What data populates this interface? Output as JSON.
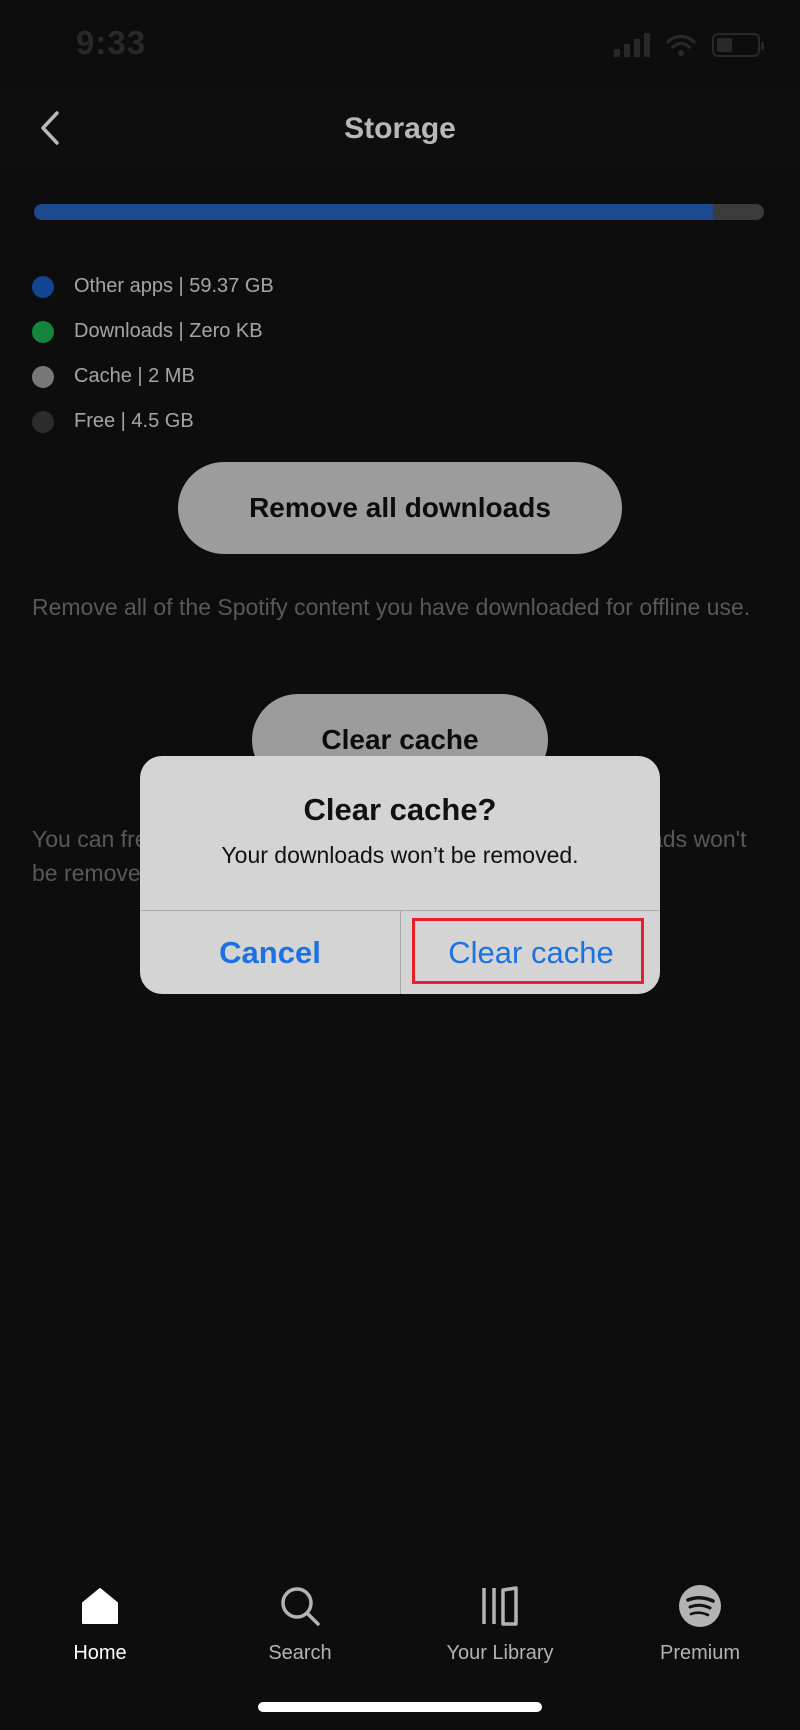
{
  "status_bar": {
    "time": "9:33"
  },
  "header": {
    "title": "Storage",
    "back_icon": "chevron-left-icon"
  },
  "storage": {
    "used_fraction": 0.93,
    "colors": {
      "other_apps": "#2a64c6",
      "free": "#535353"
    },
    "legend": [
      {
        "label": "Other apps | 59.37 GB",
        "color": "#1a5fc9"
      },
      {
        "label": "Downloads | Zero KB",
        "color": "#1db954"
      },
      {
        "label": "Cache | 2 MB",
        "color": "#a7a7a7"
      },
      {
        "label": "Free | 4.5 GB",
        "color": "#3e3e3e"
      }
    ]
  },
  "actions": {
    "remove_label": "Remove all downloads",
    "remove_desc": "Remove all of the Spotify content you have downloaded for offline use.",
    "clear_cache_label": "Clear cache",
    "cache_desc": "You can free up storage by clearing your cache. Your downloads won't be removed."
  },
  "alert": {
    "title": "Clear cache?",
    "message": "Your downloads won’t be removed.",
    "cancel_label": "Cancel",
    "confirm_label": "Clear cache",
    "button_color": "#1c72e0",
    "highlight_color": "#e8202a"
  },
  "nav": {
    "items": [
      {
        "label": "Home",
        "icon": "home-icon",
        "active": true
      },
      {
        "label": "Search",
        "icon": "search-icon",
        "active": false
      },
      {
        "label": "Your Library",
        "icon": "library-icon",
        "active": false
      },
      {
        "label": "Premium",
        "icon": "spotify-icon",
        "active": false
      }
    ]
  }
}
